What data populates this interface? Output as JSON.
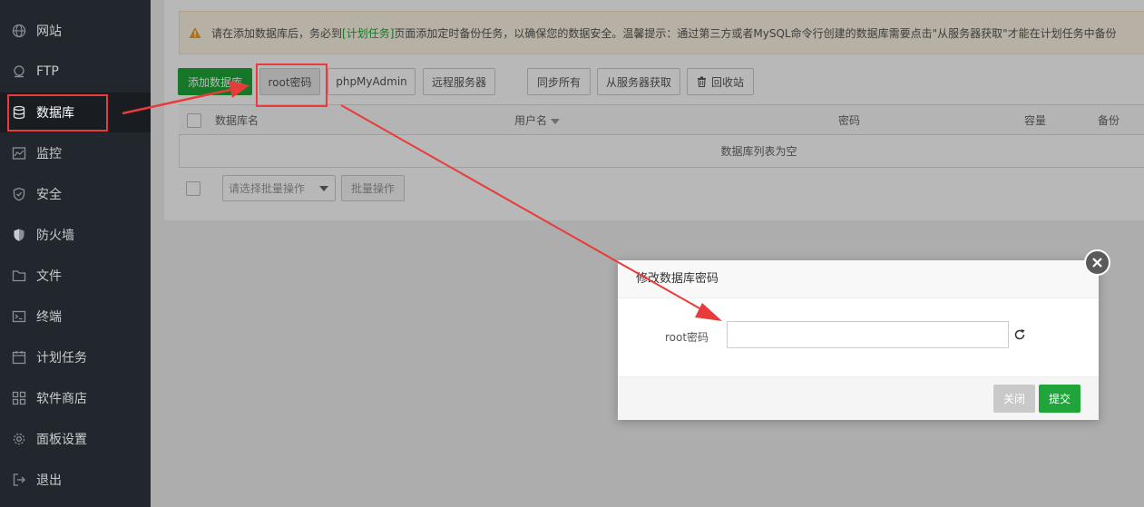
{
  "sidebar": {
    "items": [
      {
        "label": "网站",
        "icon": "globe-icon"
      },
      {
        "label": "FTP",
        "icon": "ftp-icon"
      },
      {
        "label": "数据库",
        "icon": "database-icon",
        "active": true
      },
      {
        "label": "监控",
        "icon": "monitor-icon"
      },
      {
        "label": "安全",
        "icon": "shield-icon"
      },
      {
        "label": "防火墙",
        "icon": "firewall-icon"
      },
      {
        "label": "文件",
        "icon": "folder-icon"
      },
      {
        "label": "终端",
        "icon": "terminal-icon"
      },
      {
        "label": "计划任务",
        "icon": "calendar-icon"
      },
      {
        "label": "软件商店",
        "icon": "apps-icon"
      },
      {
        "label": "面板设置",
        "icon": "gear-icon"
      },
      {
        "label": "退出",
        "icon": "logout-icon"
      }
    ]
  },
  "notice": {
    "prefix": "请在添加数据库后，务必到",
    "link": "[计划任务]",
    "suffix": "页面添加定时备份任务，以确保您的数据安全。温馨提示：通过第三方或者MySQL命令行创建的数据库需要点击\"从服务器获取\"才能在计划任务中备份"
  },
  "toolbar": {
    "add_db": "添加数据库",
    "root_pwd": "root密码",
    "phpmyadmin": "phpMyAdmin",
    "remote": "远程服务器",
    "sync_all": "同步所有",
    "fetch_server": "从服务器获取",
    "recycle": "回收站"
  },
  "table": {
    "headers": [
      "数据库名",
      "用户名",
      "密码",
      "容量",
      "备份"
    ],
    "empty": "数据库列表为空"
  },
  "batch": {
    "select_placeholder": "请选择批量操作",
    "button": "批量操作"
  },
  "modal": {
    "title": "修改数据库密码",
    "field_label": "root密码",
    "field_value": "",
    "close": "关闭",
    "submit": "提交"
  },
  "colors": {
    "accent": "#20a53a",
    "annotation": "#e83b3b",
    "sidebar_bg": "#22272e"
  }
}
